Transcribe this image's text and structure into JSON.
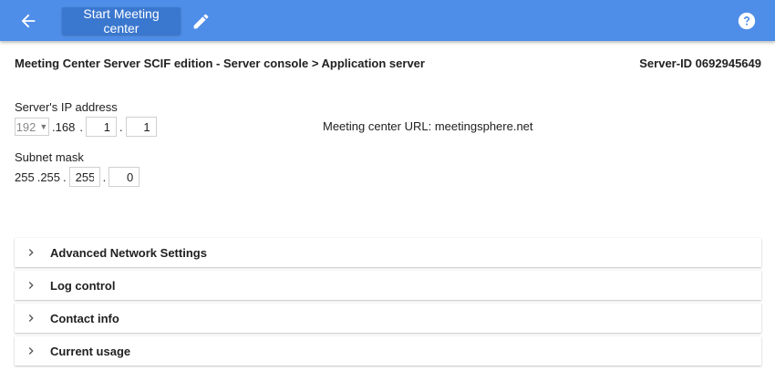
{
  "toolbar": {
    "back_icon": "arrow-back-icon",
    "start_button_label": "Start Meeting center",
    "edit_icon": "pencil-icon",
    "help_icon": "help-circle-icon",
    "bar_color": "#4f8ee8",
    "button_color": "#3a77cf"
  },
  "header": {
    "breadcrumb": "Meeting Center Server SCIF edition - Server console > Application server",
    "server_id": "Server-ID 0692945649"
  },
  "ip": {
    "label": "Server's IP address",
    "octet1": "192",
    "octet2": "168",
    "octet3": "1",
    "octet4": "1",
    "sep": "."
  },
  "meeting_url": "Meeting center URL: meetingsphere.net",
  "subnet": {
    "label": "Subnet mask",
    "octet1": "255",
    "octet2": "255",
    "octet3": "255",
    "octet4": "0",
    "sep": "."
  },
  "panels": [
    {
      "title": "Advanced Network Settings",
      "icon": "chevron-right-icon"
    },
    {
      "title": "Log control",
      "icon": "chevron-right-icon"
    },
    {
      "title": "Contact info",
      "icon": "chevron-right-icon"
    },
    {
      "title": "Current usage",
      "icon": "chevron-right-icon"
    }
  ]
}
